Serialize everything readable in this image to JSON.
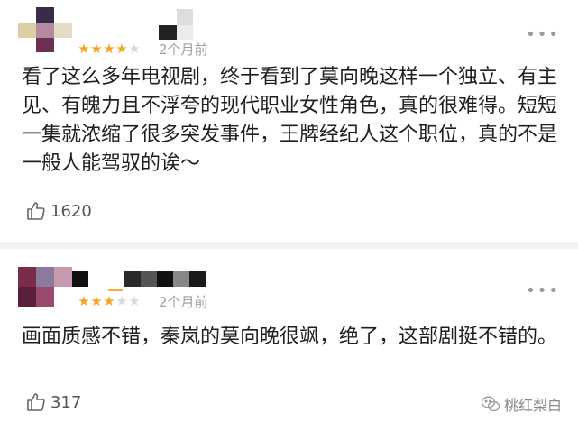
{
  "comments": [
    {
      "rating": 4,
      "time": "2个月前",
      "text": "看了这么多年电视剧，终于看到了莫向晚这样一个独立、有主见、有魄力且不浮夸的现代职业女性角色，真的很难得。短短一集就浓缩了很多突发事件，王牌经纪人这个职位，真的不是一般人能驾驭的诶～",
      "likes": "1620",
      "more_icon": "more-dots-icon"
    },
    {
      "rating": 3,
      "time": "2个月前",
      "text": "画面质感不错，秦岚的莫向晚很飒，绝了，这部剧挺不错的。",
      "likes": "317",
      "more_icon": "more-dots-icon"
    }
  ],
  "watermark": {
    "text": "桃红梨白",
    "icon": "wechat-icon"
  },
  "colors": {
    "star_on": "#f5a623",
    "star_off": "#d9d9d9",
    "divider": "#f2f2f2"
  }
}
